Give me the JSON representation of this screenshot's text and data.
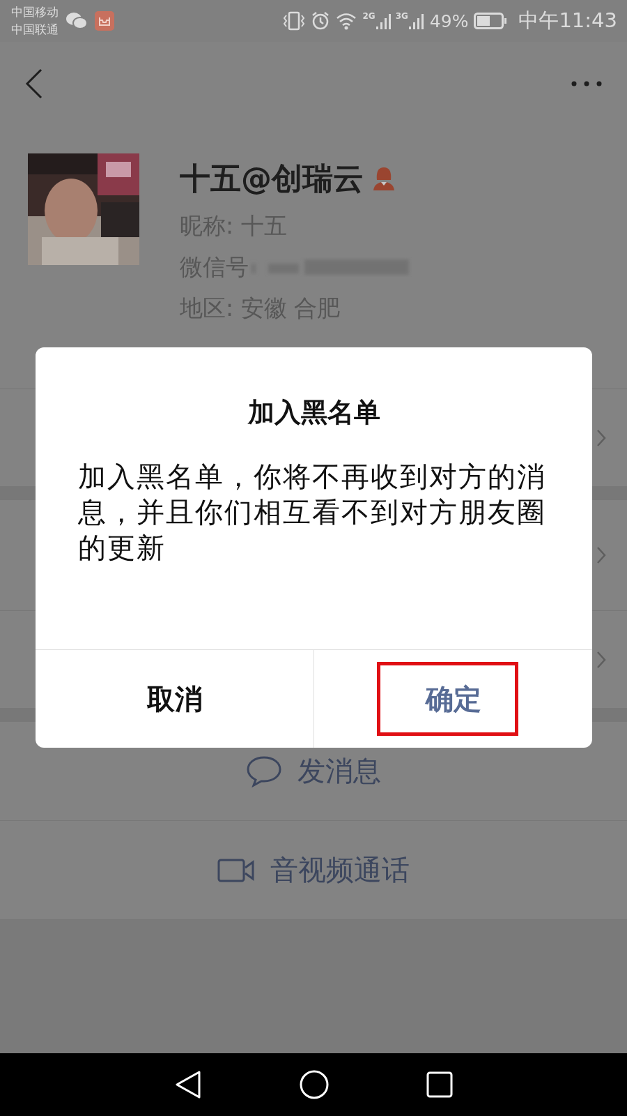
{
  "status_bar": {
    "carriers": [
      "中国移动",
      "中国联通"
    ],
    "signals": [
      {
        "label": "2G"
      },
      {
        "label": "3G"
      }
    ],
    "battery_text": "49%",
    "time": "中午11:43"
  },
  "profile": {
    "name": "十五@创瑞云",
    "fields": [
      {
        "kind": "text",
        "text": "昵称: 十五"
      },
      {
        "kind": "blurred",
        "text": "微信号"
      },
      {
        "kind": "text",
        "text": "地区: 安徽  合肥"
      }
    ]
  },
  "actions": [
    {
      "kind": "message",
      "label": "发消息"
    },
    {
      "kind": "video",
      "label": "音视频通话"
    }
  ],
  "dialog": {
    "title": "加入黑名单",
    "message": "加入黑名单，你将不再收到对方的消息，并且你们相互看不到对方朋友圈的更新",
    "buttons": [
      {
        "kind": "cancel",
        "label": "取消",
        "highlighted": false
      },
      {
        "kind": "confirm",
        "label": "确定",
        "highlighted": true
      }
    ]
  }
}
